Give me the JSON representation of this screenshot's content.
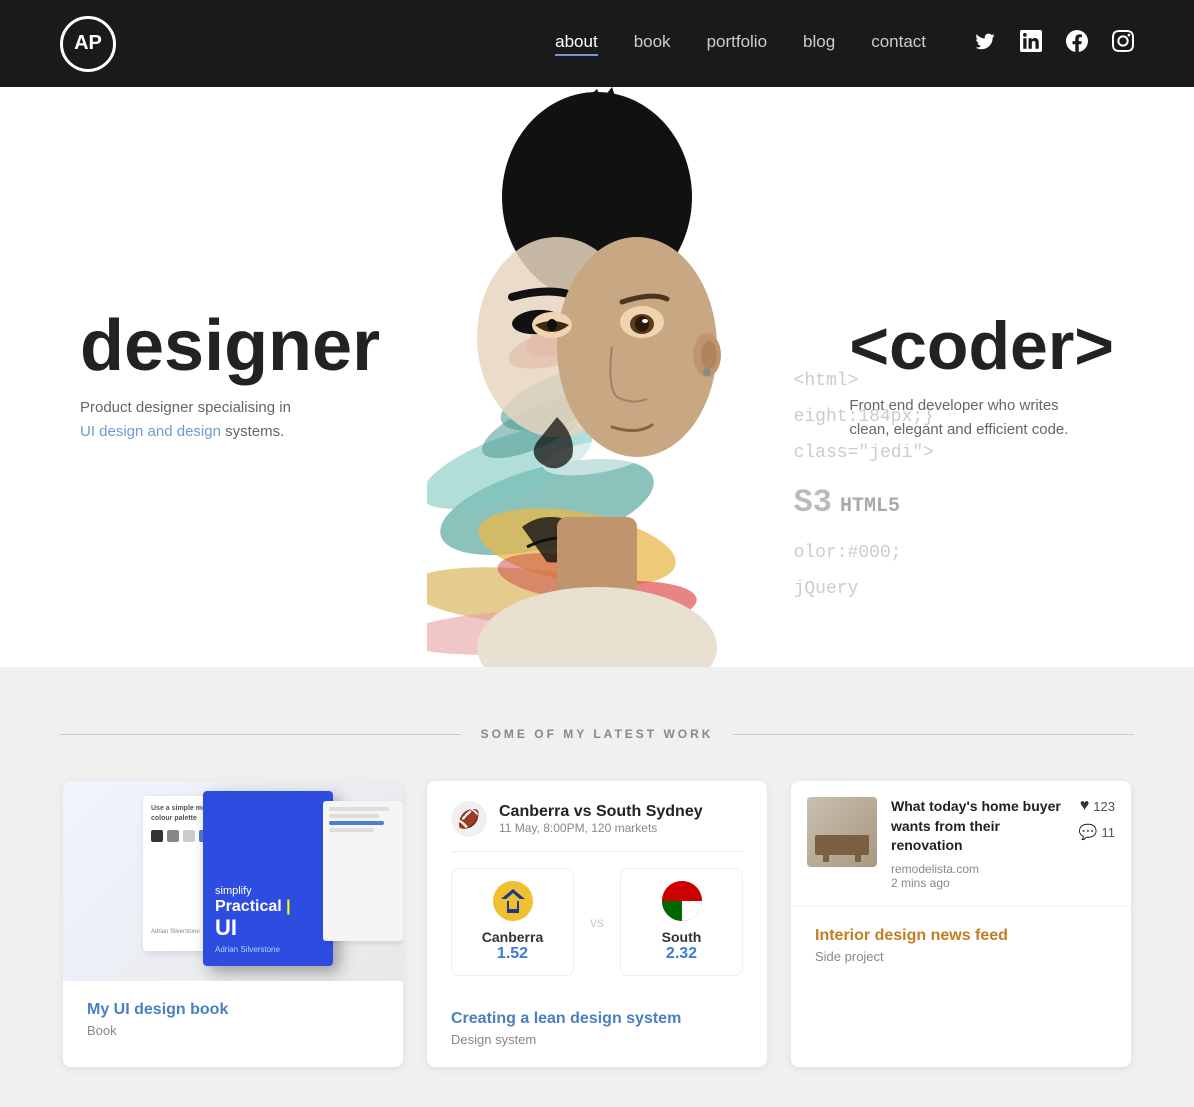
{
  "header": {
    "logo_text": "AP",
    "nav": {
      "items": [
        "about",
        "book",
        "portfolio",
        "blog",
        "contact"
      ],
      "active": "about"
    },
    "social": {
      "twitter": "𝕏",
      "linkedin": "in",
      "facebook": "f",
      "instagram": "◻"
    }
  },
  "hero": {
    "left_title": "designer",
    "left_desc_plain": "Product designer specialising in UI design and design systems.",
    "left_desc_highlight": "UI design and design systems",
    "right_title": "<coder>",
    "right_desc": "Front end developer who writes clean, elegant and efficient code.",
    "code_lines": [
      "<html>",
      "eight:184px;}",
      "class=\"jedi\">",
      "S3 HTML5",
      "olor:#000;",
      "jQuery"
    ]
  },
  "work_section": {
    "title": "SOME OF MY LATEST WORK",
    "cards": [
      {
        "id": "book",
        "title": "My UI design book",
        "subtitle": "Book",
        "book_cover_line1": "Practical",
        "book_cover_line2": "UI"
      },
      {
        "id": "sports",
        "title": "Creating a lean design system",
        "subtitle": "Design system",
        "match_title": "Canberra vs South Sydney",
        "match_info": "11 May, 8:00PM, 120 markets",
        "team1_name": "Canberra",
        "team1_score": "1.52",
        "team2_name": "South",
        "team2_score": "2.32"
      },
      {
        "id": "news",
        "title": "Interior design news feed",
        "subtitle": "Side project",
        "news_item_title": "What today's home buyer wants from their renovation",
        "news_item_source": "remodelista.com",
        "news_item_time": "2 mins ago",
        "news_item_likes": "123",
        "news_item_comments": "11"
      }
    ]
  }
}
